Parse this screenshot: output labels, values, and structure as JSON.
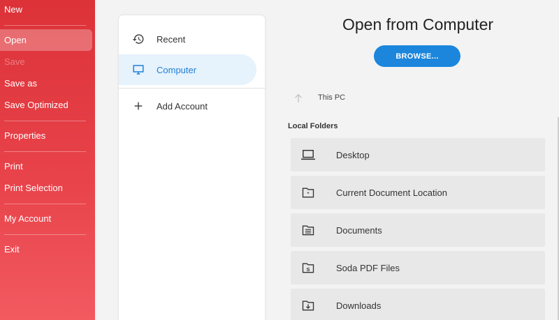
{
  "sidebar": {
    "items": [
      {
        "label": "New",
        "state": "normal"
      },
      {
        "label": "Open",
        "state": "active"
      },
      {
        "label": "Save",
        "state": "disabled"
      },
      {
        "label": "Save as",
        "state": "normal"
      },
      {
        "label": "Save Optimized",
        "state": "normal"
      },
      {
        "label": "Properties",
        "state": "normal"
      },
      {
        "label": "Print",
        "state": "normal"
      },
      {
        "label": "Print Selection",
        "state": "normal"
      },
      {
        "label": "My Account",
        "state": "normal"
      },
      {
        "label": "Exit",
        "state": "normal"
      }
    ]
  },
  "locations": {
    "items": [
      {
        "label": "Recent",
        "icon": "history-icon"
      },
      {
        "label": "Computer",
        "icon": "monitor-icon",
        "selected": true
      },
      {
        "label": "Add Account",
        "icon": "plus-icon"
      }
    ]
  },
  "content": {
    "title": "Open from Computer",
    "browse_label": "BROWSE...",
    "path_label": "This PC",
    "section_title": "Local Folders",
    "folders": [
      {
        "label": "Desktop",
        "icon": "laptop-icon"
      },
      {
        "label": "Current Document Location",
        "icon": "folder-star-icon"
      },
      {
        "label": "Documents",
        "icon": "folder-document-icon"
      },
      {
        "label": "Soda PDF Files",
        "icon": "folder-s-icon"
      },
      {
        "label": "Downloads",
        "icon": "folder-download-icon"
      }
    ]
  },
  "colors": {
    "sidebar_red": "#dc3238",
    "accent_blue": "#1b86dc",
    "selected_bg": "#e6f2fc"
  }
}
